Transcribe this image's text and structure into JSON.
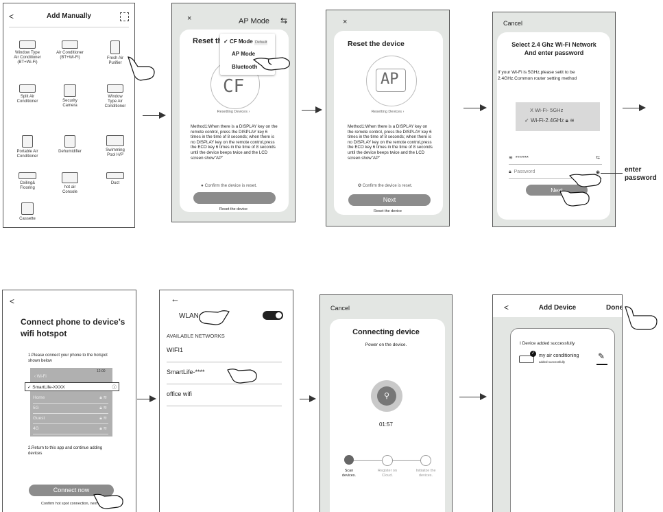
{
  "p1": {
    "title": "Add Manually",
    "back": "<",
    "items": [
      "Window Type\nAir Conditioner\n(BT+Wi-Fi)",
      "Air Conditioner\n(BT+Wi-Fi)",
      "Fresh Air\nPurifier",
      "Split Air\nConditioner",
      "Security\nCamera",
      "Window\nType Air\nConditioner",
      "Portable Air\nConditioner",
      "Dehumidifier",
      "Swimming\nPool H/P",
      "Ceiling&\nFlooring",
      "hot air\nConsole",
      "Duct",
      "Cassette"
    ]
  },
  "p2": {
    "close": "×",
    "mode": "AP Mode",
    "title": "Reset th",
    "menu": {
      "cf": "CF Mode",
      "cf_default": "Default",
      "ap": "AP Mode",
      "bt": "Bluetooth"
    },
    "display": "CF",
    "resetting": "Resetting Devices ›",
    "method": "Method1:When there is a DISPLAY key on the remote control, press the DISPLAY key 6 times in the time of 8 seconds; when there is no DISPLAY key on the remote control,press the ECO key 6 times in the time of 8 seconds until the device beeps twice and the LCD screen show\"AP\"",
    "confirm": "Confirm the device is reset.",
    "footer": "Reset the device"
  },
  "p3": {
    "close": "×",
    "title": "Reset the device",
    "display": "AP",
    "resetting": "Resetting Devices ›",
    "method": "Method1:When there is a DISPLAY key on the remote control, press the DISPLAY key 6 times in the time of 8 seconds; when there is no DISPLAY key on the remote control,press the ECO key 6 times in the time of 8 seconds until the device beeps twice and the LCD screen show\"AP\"",
    "confirm": "Confirm the device is reset.",
    "next": "Next",
    "footer": "Reset the device"
  },
  "p4": {
    "cancel": "Cancel",
    "title1": "Select 2.4 Ghz Wi-Fi Network",
    "title2": "And enter password",
    "desc": "If your Wi-Fi is 5GHz,please setit to be 2.4GHz.Common router setting method",
    "wifi5": "Wi-Fi- 5GHz",
    "wifi24": "Wi-Fi-2.4GHz",
    "ssid": "*******",
    "password_placeholder": "Password",
    "next": "Next",
    "annotation": "enter\npassword"
  },
  "p5": {
    "back": "<",
    "title1": "Connect phone to device’s",
    "title2": "wifi hotspot",
    "step1": "1.Please connect your phone to the hotspot shown below",
    "status_time": "12:00",
    "wifi_back": "‹ Wi-Fi",
    "selected": "✓ SmartLife-XXXX",
    "networks": [
      "Home",
      "5G",
      "Guest",
      "4G"
    ],
    "step2": "2.Return to this app and continue adding devices",
    "connect": "Connect now",
    "footer": "Confirm hot spot connection, next"
  },
  "p6": {
    "back": "←",
    "wlan": "WLAN",
    "available": "AVAILABLE NETWORKS",
    "networks": [
      "WIFI1",
      "SmartLife-****",
      "office wifi"
    ]
  },
  "p7": {
    "cancel": "Cancel",
    "title": "Connecting device",
    "subtitle": "Power on the device.",
    "timer": "01:57",
    "steps": [
      "Scan\ndevices.",
      "Register on\nCloud.",
      "Initialize the\ndevices."
    ]
  },
  "p8": {
    "back": "<",
    "title": "Add Device",
    "done": "Done",
    "count": "I Device added successfully",
    "device": "my air conditioning",
    "device_sub": "added successfully"
  },
  "colors": {
    "pill": "#8c8c8c",
    "panel": "#e3e6e3",
    "wifi_box": "#d9d9d9"
  }
}
